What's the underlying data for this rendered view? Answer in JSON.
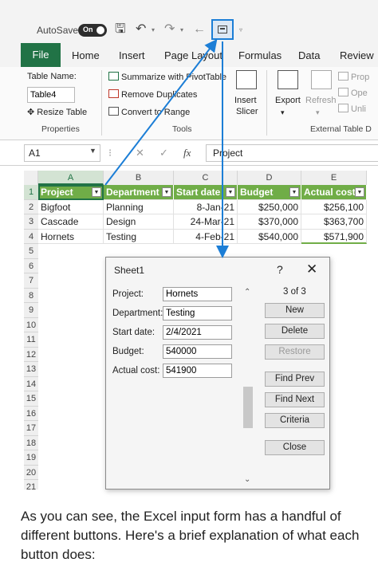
{
  "titlebar": {
    "autosave_label": "AutoSave",
    "autosave_state": "On",
    "icons": [
      "save-icon",
      "undo-icon",
      "redo-icon",
      "back-icon",
      "form-icon",
      "customize-qat-icon"
    ]
  },
  "ribbon_tabs": [
    "File",
    "Home",
    "Insert",
    "Page Layout",
    "Formulas",
    "Data",
    "Review"
  ],
  "ribbon": {
    "table_name_label": "Table Name:",
    "table_name_value": "Table4",
    "resize_table": "Resize Table",
    "properties_group": "Properties",
    "summarize_pivot": "Summarize with PivotTable",
    "remove_duplicates": "Remove Duplicates",
    "convert_to_range": "Convert to Range",
    "tools_group": "Tools",
    "insert_slicer_line1": "Insert",
    "insert_slicer_line2": "Slicer",
    "export": "Export",
    "refresh": "Refresh",
    "properties_cut": "Prop",
    "open_cut": "Ope",
    "unlink_cut": "Unli",
    "external_group": "External Table D"
  },
  "formula_bar": {
    "name_box": "A1",
    "cancel": "✕",
    "enter": "✓",
    "fx": "fx",
    "content": "Project"
  },
  "sheet": {
    "columns": [
      "A",
      "B",
      "C",
      "D",
      "E"
    ],
    "rows": [
      "1",
      "2",
      "3",
      "4",
      "5",
      "6",
      "7",
      "8",
      "9",
      "10",
      "11",
      "12",
      "13",
      "14",
      "15",
      "16",
      "17",
      "18",
      "19",
      "20",
      "21"
    ],
    "headers": [
      "Project",
      "Department",
      "Start date",
      "Budget",
      "Actual cost"
    ],
    "data": [
      [
        "Bigfoot",
        "Planning",
        "8-Jan-21",
        "$250,000",
        "$256,100"
      ],
      [
        "Cascade",
        "Design",
        "24-Mar-21",
        "$370,000",
        "$363,700"
      ],
      [
        "Hornets",
        "Testing",
        "4-Feb-21",
        "$540,000",
        "$571,900"
      ]
    ],
    "colors": {
      "header_fill": "#70ad47",
      "accent": "#217346"
    }
  },
  "dialog": {
    "title": "Sheet1",
    "help": "?",
    "close": "✕",
    "fields": [
      {
        "label": "Project:",
        "value": "Hornets"
      },
      {
        "label": "Department:",
        "value": "Testing"
      },
      {
        "label": "Start date:",
        "value": "2/4/2021"
      },
      {
        "label": "Budget:",
        "value": "540000"
      },
      {
        "label": "Actual cost:",
        "value": "541900"
      }
    ],
    "record_counter": "3 of 3",
    "buttons": {
      "new": "New",
      "delete": "Delete",
      "restore": "Restore",
      "find_prev": "Find Prev",
      "find_next": "Find Next",
      "criteria": "Criteria",
      "close": "Close"
    }
  },
  "caption": "As you can see, the Excel input form has a handful of different buttons. Here's a brief explanation of what each button does:"
}
